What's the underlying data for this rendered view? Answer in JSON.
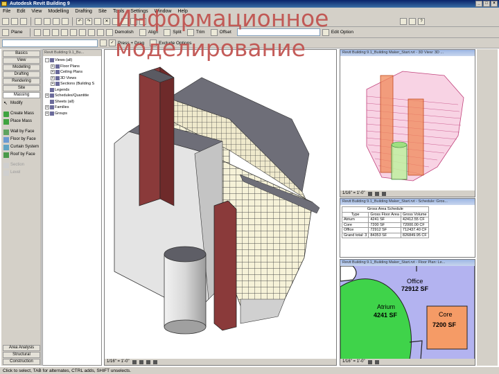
{
  "window": {
    "title": "Autodesk Revit Building 9"
  },
  "overlay_title": {
    "line1": "Информационное",
    "line2": "моделирование"
  },
  "menu": [
    "File",
    "Edit",
    "View",
    "Modelling",
    "Drafting",
    "Site",
    "Tools",
    "Settings",
    "Window",
    "Help"
  ],
  "toolbar2": {
    "plane": "Plane",
    "demolish": "Demolish",
    "align": "Align",
    "split": "Split",
    "trim": "Trim",
    "offset": "Offset",
    "edit_option": "Edit Option"
  },
  "toolbar3": {
    "press_drag": "Press + Drag",
    "exclude_options": "Exclude Options"
  },
  "design_bar": {
    "tabs": [
      "Basics",
      "View",
      "Modelling",
      "Drafting",
      "Rendering",
      "Site",
      "Massing"
    ],
    "tools": [
      {
        "label": "Modify",
        "icon": "arrow-icon",
        "disabled": false
      },
      {
        "label": "Create Mass",
        "icon": "mass-icon",
        "disabled": false
      },
      {
        "label": "Place Mass",
        "icon": "mass-icon",
        "disabled": false
      },
      {
        "label": "Wall by Face",
        "icon": "wall-icon",
        "disabled": false
      },
      {
        "label": "Floor by Face",
        "icon": "floor-icon",
        "disabled": false
      },
      {
        "label": "Curtain System",
        "icon": "curtain-icon",
        "disabled": false
      },
      {
        "label": "Roof by Face",
        "icon": "roof-icon",
        "disabled": false
      },
      {
        "label": "Section",
        "icon": "section-icon",
        "disabled": true
      },
      {
        "label": "Level",
        "icon": "level-icon",
        "disabled": true
      }
    ],
    "bottom_tabs": [
      "Area Analysis",
      "Structural",
      "Construction"
    ]
  },
  "browser": {
    "title": "Revit Building 9.1_Bu...",
    "items": [
      {
        "label": "Views (all)",
        "level": 0,
        "exp": "-"
      },
      {
        "label": "Floor Plans",
        "level": 1,
        "exp": "+"
      },
      {
        "label": "Ceiling Plans",
        "level": 1,
        "exp": "+"
      },
      {
        "label": "3D Views",
        "level": 1,
        "exp": "+"
      },
      {
        "label": "Sections (Building S",
        "level": 1,
        "exp": "+"
      },
      {
        "label": "Legends",
        "level": 0,
        "exp": ""
      },
      {
        "label": "Schedules/Quantitie",
        "level": 0,
        "exp": "+"
      },
      {
        "label": "Sheets (all)",
        "level": 0,
        "exp": ""
      },
      {
        "label": "Families",
        "level": 0,
        "exp": "+"
      },
      {
        "label": "Groups",
        "level": 0,
        "exp": "+"
      }
    ]
  },
  "views": {
    "main": {
      "scale": "1/16\" = 1'-0\""
    },
    "view3d": {
      "title": "Revit Building 9.1_Building Maker_Start.rvt - 3D View: 3D ...",
      "scale": "1/16\" = 1'-0\""
    },
    "schedule": {
      "title": "Revit Building 9.1_Building Maker_Start.rvt - Schedule: Gros...",
      "heading": "Gross Area Schedule",
      "columns": [
        "Type",
        "Gross Floor Area",
        "Gross Volume"
      ],
      "rows": [
        [
          "Atrium",
          "4241 SF",
          "42412.55 CF"
        ],
        [
          "Core",
          "7200 SF",
          "72000.00 CF"
        ],
        [
          "Office",
          "72912 SF",
          "712437.40 CF"
        ],
        [
          "Grand total: 3",
          "84353 SF",
          "826849.95 CF"
        ]
      ]
    },
    "floorplan": {
      "title": "Revit Building 9.1_Building Maker_Start.rvt - Floor Plan: Le...",
      "scale": "1/16\" = 1'-0\"",
      "office_label": "Office",
      "office_area": "72912 SF",
      "atrium_label": "Atrium",
      "atrium_area": "4241 SF",
      "core_label": "Core",
      "core_area": "7200 SF"
    }
  },
  "status": "Click to select, TAB for alternates, CTRL adds, SHIFT unselects.",
  "colors": {
    "office": "#b3b3f0",
    "atrium": "#3fd34a",
    "core": "#f59b66",
    "brick": "#8a3a3a"
  }
}
